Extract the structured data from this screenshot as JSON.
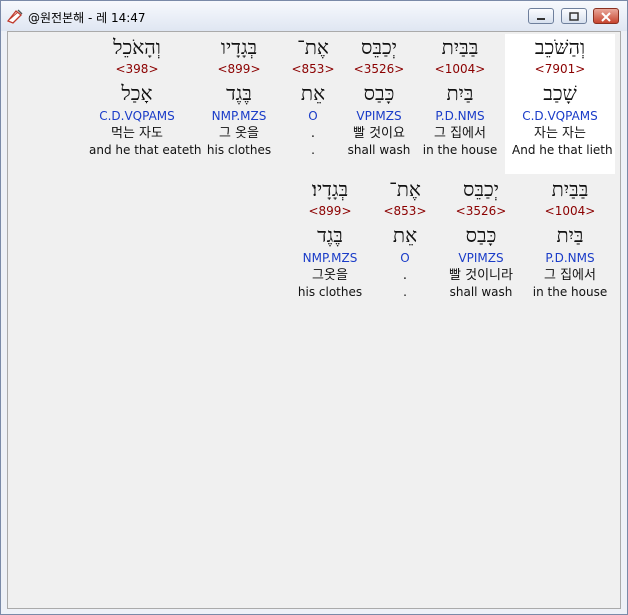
{
  "window": {
    "title": "@원전본해 - 레 14:47",
    "controls": {
      "minimize_icon": "minimize-icon",
      "maximize_icon": "maximize-icon",
      "close_icon": "close-icon"
    }
  },
  "colors": {
    "strong_number": "#8b0000",
    "parsing": "#1a3cc8",
    "selection": "#ffffff"
  },
  "rows": [
    {
      "words": [
        {
          "hebrew": "וְהַשֹּׁכֵב",
          "strong": "<7901>",
          "lemma": "שָׁכַב",
          "parsing": "C.D.VQPAMS",
          "korean": "자는 자는",
          "english": "And he that lieth",
          "selected": true
        },
        {
          "hebrew": "בַּבַּיִת",
          "strong": "<1004>",
          "lemma": "בַּיִת",
          "parsing": "P.D.NMS",
          "korean": "그 집에서",
          "english": "in the house"
        },
        {
          "hebrew": "יְכַבֵּס",
          "strong": "<3526>",
          "lemma": "כָּבַס",
          "parsing": "VPIMZS",
          "korean": "빨 것이요",
          "english": "shall wash"
        },
        {
          "hebrew": "אֶת־",
          "strong": "<853>",
          "lemma": "אֵת",
          "parsing": "O",
          "korean": ".",
          "english": "."
        },
        {
          "hebrew": "בְּגָדָיו",
          "strong": "<899>",
          "lemma": "בֶּגֶד",
          "parsing": "NMP.MZS",
          "korean": "그 옷을",
          "english": "his clothes"
        },
        {
          "hebrew": "וְהָאֹכֵל",
          "strong": "<398>",
          "lemma": "אָכַל",
          "parsing": "C.D.VQPAMS",
          "korean": "먹는 자도",
          "english": "and he that eateth"
        }
      ]
    },
    {
      "words": [
        {
          "hebrew": "בַּבַּיִת",
          "strong": "<1004>",
          "lemma": "בַּיִת",
          "parsing": "P.D.NMS",
          "korean": "그 집에서",
          "english": "in the house"
        },
        {
          "hebrew": "יְכַבֵּס",
          "strong": "<3526>",
          "lemma": "כָּבַס",
          "parsing": "VPIMZS",
          "korean": "빨 것이니라",
          "english": "shall wash"
        },
        {
          "hebrew": "אֶת־",
          "strong": "<853>",
          "lemma": "אֵת",
          "parsing": "O",
          "korean": ".",
          "english": "."
        },
        {
          "hebrew": "בְּגָדָיו׃",
          "strong": "<899>",
          "lemma": "בֶּגֶד",
          "parsing": "NMP.MZS",
          "korean": "그옷을",
          "english": "his clothes"
        }
      ]
    }
  ]
}
